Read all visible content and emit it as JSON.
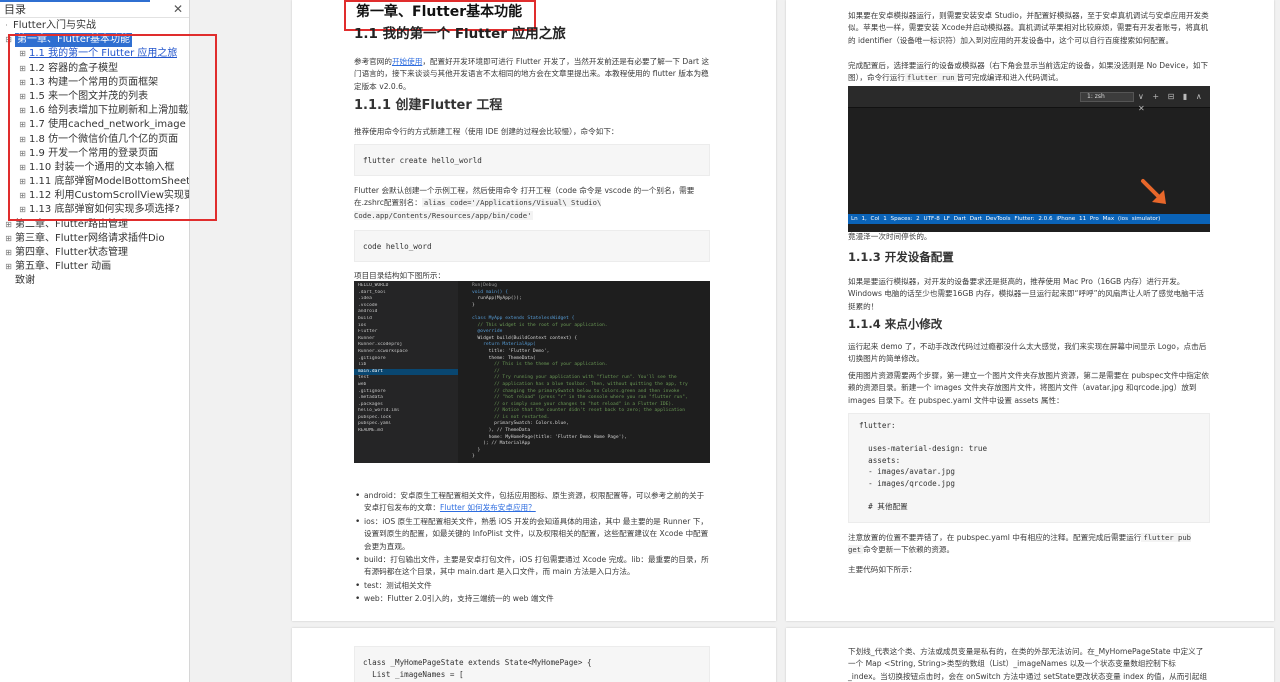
{
  "sidebar": {
    "title": "目录",
    "close": "✕",
    "items": [
      {
        "label": "Flutter入门与实战",
        "level": "root",
        "expander": "",
        "active": false,
        "link": false
      },
      {
        "label": "第一章、Flutter基本功能",
        "level": "lvl0",
        "expander": "⊟",
        "active": true,
        "link": false
      },
      {
        "label": "1.1 我的第一个 Flutter 应用之旅",
        "level": "lvl1",
        "expander": "⊞",
        "active": false,
        "link": true
      },
      {
        "label": "1.2 容器的盒子模型",
        "level": "lvl1",
        "expander": "⊞",
        "active": false,
        "link": false
      },
      {
        "label": "1.3 构建一个常用的页面框架",
        "level": "lvl1",
        "expander": "⊞",
        "active": false,
        "link": false
      },
      {
        "label": "1.5 来一个图文并茂的列表",
        "level": "lvl1",
        "expander": "⊞",
        "active": false,
        "link": false
      },
      {
        "label": "1.6 给列表增加下拉刷新和上滑加载更多功",
        "level": "lvl1",
        "expander": "⊞",
        "active": false,
        "link": false
      },
      {
        "label": "1.7 使用cached_network_image 优化图",
        "level": "lvl1",
        "expander": "⊞",
        "active": false,
        "link": false
      },
      {
        "label": "1.8 仿一个微信价值几个亿的页面",
        "level": "lvl1",
        "expander": "⊞",
        "active": false,
        "link": false
      },
      {
        "label": "1.9 开发一个常用的登录页面",
        "level": "lvl1",
        "expander": "⊞",
        "active": false,
        "link": false
      },
      {
        "label": "1.10 封装一个通用的文本输入框",
        "level": "lvl1",
        "expander": "⊞",
        "active": false,
        "link": false
      },
      {
        "label": "1.11 底部弹窗ModelBottomSheet详解",
        "level": "lvl1",
        "expander": "⊞",
        "active": false,
        "link": false
      },
      {
        "label": "1.12 利用CustomScrollView实现更有趣",
        "level": "lvl1",
        "expander": "⊞",
        "active": false,
        "link": false
      },
      {
        "label": "1.13 底部弹窗如何实现多项选择?",
        "level": "lvl1",
        "expander": "⊞",
        "active": false,
        "link": false
      },
      {
        "label": "第二章、Flutter路由管理",
        "level": "lvl0",
        "expander": "⊞",
        "active": false,
        "link": false
      },
      {
        "label": "第三章、Flutter网络请求插件Dio",
        "level": "lvl0",
        "expander": "⊞",
        "active": false,
        "link": false
      },
      {
        "label": "第四章、Flutter状态管理",
        "level": "lvl0",
        "expander": "⊞",
        "active": false,
        "link": false
      },
      {
        "label": "第五章、Flutter 动画",
        "level": "lvl0",
        "expander": "⊞",
        "active": false,
        "link": false
      },
      {
        "label": "致谢",
        "level": "lvl0",
        "expander": "",
        "active": false,
        "link": false
      }
    ]
  },
  "page1": {
    "chapter_title": "第一章、Flutter基本功能",
    "section_title": "1.1 我的第一个 Flutter 应用之旅",
    "intro_a": "参考官网的",
    "intro_link": "开始使用",
    "intro_b": "，配置好开发环境即可进行 Flutter 开发了，当然开发前还是有必要了解一下 Dart 这门语言的，接下来谈谈与其他开发语言不太相同的地方会在文章里提出来。本教程使用的 flutter 版本为稳定版本 v2.0.6。",
    "h_create": "1.1.1 创建Flutter 工程",
    "cmd_intro": "推荐使用命令行的方式新建工程（使用 IDE 创建的过程会比较慢），命令如下：",
    "code_create": "flutter create hello_world",
    "create_a": "Flutter 会默认创建一个示例工程，然后使用命令 打开工程（code 命令是 vscode 的一个别名，需要在.zshrc配置别名：",
    "create_inline": "alias code='/Applications/Visual\\ Studio\\ Code.app/Contents/Resources/app/bin/code'",
    "code_open": "code hello_word",
    "struct_intro": "项目目录结构如下图所示：",
    "ide_tree": [
      "HELLO_WORLD",
      "  .dart_tool",
      "  .idea",
      "  .vscode",
      "  android",
      "  build",
      "  ios",
      "    Flutter",
      "    Runner",
      "    Runner.xcodeproj",
      "    Runner.xcworkspace",
      "    .gitignore",
      "  lib",
      "    main.dart",
      "  test",
      "  web",
      "  .gitignore",
      "  .metadata",
      "  .packages",
      "  hello_world.iml",
      "  pubspec.lock",
      "  pubspec.yaml",
      "  README.md"
    ],
    "ide_code": [
      "Run|Debug",
      "void main() {",
      "  runApp(MyApp());",
      "}",
      "",
      "class MyApp extends StatelessWidget {",
      "  // This widget is the root of your application.",
      "  @override",
      "  Widget build(BuildContext context) {",
      "    return MaterialApp(",
      "      title: 'Flutter Demo',",
      "      theme: ThemeData(",
      "        // This is the theme of your application.",
      "        //",
      "        // Try running your application with \"flutter run\". You'll see the",
      "        // application has a blue toolbar. Then, without quitting the app, try",
      "        // changing the primarySwatch below to Colors.green and then invoke",
      "        // \"hot reload\" (press \"r\" in the console where you ran \"flutter run\",",
      "        // or simply save your changes to \"hot reload\" in a Flutter IDE).",
      "        // Notice that the counter didn't reset back to zero; the application",
      "        // is not restarted.",
      "        primarySwatch: Colors.blue,",
      "      ), // ThemeData",
      "      home: MyHomePage(title: 'Flutter Demo Home Page'),",
      "    ); // MaterialApp",
      "  }",
      "}",
      "",
      "class MyHomePage extends StatefulWidget {",
      "  MyHomePage({Key key, this.title}) : super(key: key);"
    ],
    "bullets": [
      {
        "text": "android：安卓原生工程配置相关文件，包括应用图标、原生资源，权限配置等，可以参考之前的关于安卓打包发布的文章：",
        "link": "Flutter 如何发布安卓应用？"
      },
      {
        "text": "ios：iOS 原生工程配置相关文件，熟悉 iOS 开发的会知道具体的用途，其中 最主要的是 Runner 下，设置到原生的配置，如最关键的 InfoPlist 文件，以及权限相关的配置，这些配置建议在 Xcode 中配置会更为直观。",
        "link": ""
      },
      {
        "text": "build：打包输出文件，主要是安卓打包文件，iOS 打包需要通过 Xcode 完成。lib：最重要的目录，所有源码都在这个目录，其中 main.dart 是入口文件，而 main 方法是入口方法。",
        "link": ""
      },
      {
        "text": "test：测试相关文件",
        "link": ""
      },
      {
        "text": "web：Flutter 2.0引入的，支持三端统一的 web 端文件",
        "link": ""
      }
    ]
  },
  "page2": {
    "intro": "如果要在安卓模拟器运行，则需要安装安卓 Studio，并配置好模拟器，至于安卓真机调试与安卓应用开发类似。苹果也一样，需要安装 Xcode并启动模拟器。真机调试苹果相对比较麻烦，需要有开发者账号，将真机的 identifier（设备唯一标识符）加入到对应用的开发设备中，这个可以自行百度搜索如何配置。",
    "run_a": "完成配置后，选择要运行的设备或模拟器（右下角会显示当前选定的设备，如果没选则是 No Device，如下图），命令行运行",
    "run_inline": "flutter run",
    "run_b": "皆可完成编译和进入代码调试。",
    "terminal_select": "1: zsh",
    "terminal_icons": "∨ + ⊟ ▮ ∧ ✕",
    "terminal_status": "Ln 1, Col 1   Spaces: 2   UTF-8   LF   Dart   Dart DevTools   Flutter: 2.0.6   iPhone 11 Pro Max (ios simulator)",
    "wait_text": "竟漫泽一次时间停长的。",
    "h_device": "1.1.3 开发设备配置",
    "device_text": "如果是要运行模拟器，对开发的设备要求还是挺高的，推荐使用 Mac Pro（16GB 内存）进行开发。Windows 电脑的话至少也需要16GB 内存，模拟器一旦运行起来即“呼呼”的风扇声让人听了感觉电脑干活挺累的！",
    "h_mod": "1.1.4 来点小修改",
    "demo_text": "运行起来 demo 了，不动手改改代码过过瘾都没什么太大感觉，我们来实现在屏幕中间显示 Logo，点击后切换图片的简单修改。",
    "images_text": "使用图片资源需要两个步骤，第一建立一个图片文件夹存放图片资源，第二是需要在 pubspec文件中指定依赖的资源目录。新建一个 images 文件夹存放图片文件，将图片文件（avatar.jpg 和qrcode.jpg）放到images 目录下。在 pubspec.yaml 文件中设置 assets 属性：",
    "yaml_code": "flutter:\n\n  uses-material-design: true\n  assets:\n  - images/avatar.jpg\n  - images/qrcode.jpg\n\n  # 其他配置",
    "note_a": "注意放置的位置不要弄错了，在 pubspec.yaml 中有相应的注释。配置完成后需要运行",
    "note_inline": "flutter pub get",
    "note_b": "命令更新一下依赖的资源。",
    "main_code": "主要代码如下所示："
  },
  "page3": {
    "code": "class _MyHomePageState extends State<MyHomePage> {\n  List _imageNames = [\n    'images/avatar.jpg',\n    'images/qrcode.jpg',"
  },
  "page4": {
    "text": "下划线_代表这个类、方法或成员变量是私有的，在类的外部无法访问。在_MyHomePageState 中定义了一个 Map <String, String>类型的数组（List）_imageNames 以及一个状态变量数组控制下标 _index。当切换按钮点击时，会在 onSwitch 方法中通过 setState更改状态变量 index 的值，从而引起组件的重新构建。"
  },
  "colors": {
    "accent": "#2f6fd1",
    "highlight_box": "#e02d2d",
    "status_bar": "#0a63b8",
    "arrow": "#e8672a"
  }
}
